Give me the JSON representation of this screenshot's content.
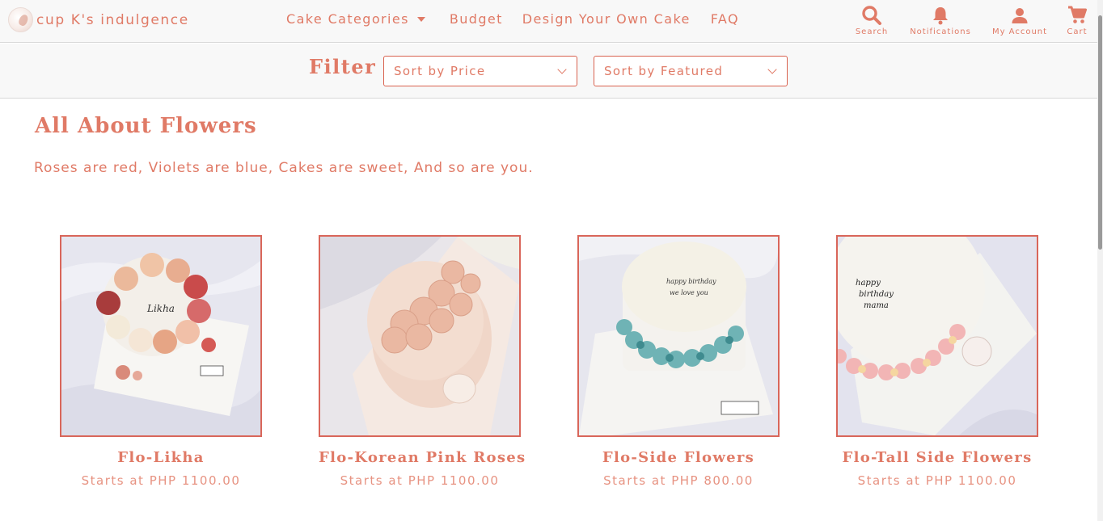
{
  "brand": {
    "name": "cup K's indulgence"
  },
  "nav": {
    "categories": "Cake Categories",
    "budget": "Budget",
    "design": "Design Your Own Cake",
    "faq": "FAQ"
  },
  "actions": {
    "search": {
      "label": "Search",
      "icon": "search-icon"
    },
    "notifications": {
      "label": "Notifications",
      "icon": "bell-icon"
    },
    "account": {
      "label": "My Account",
      "icon": "person-icon"
    },
    "cart": {
      "label": "Cart",
      "icon": "cart-icon"
    }
  },
  "filter": {
    "title": "Filter",
    "sort_price": "Sort by Price",
    "sort_featured": "Sort by Featured"
  },
  "section": {
    "title": "All About Flowers",
    "subtitle": "Roses are red, Violets are blue, Cakes are sweet, And so are you."
  },
  "products": [
    {
      "name": "Flo-Likha",
      "price": "Starts at PHP 1100.00"
    },
    {
      "name": "Flo-Korean Pink Roses",
      "price": "Starts at PHP 1100.00"
    },
    {
      "name": "Flo-Side Flowers",
      "price": "Starts at PHP 800.00"
    },
    {
      "name": "Flo-Tall Side Flowers",
      "price": "Starts at PHP 1100.00"
    }
  ],
  "colors": {
    "accent": "#e07a66",
    "border": "#d9665a",
    "header_bg": "#f8f8f8"
  }
}
